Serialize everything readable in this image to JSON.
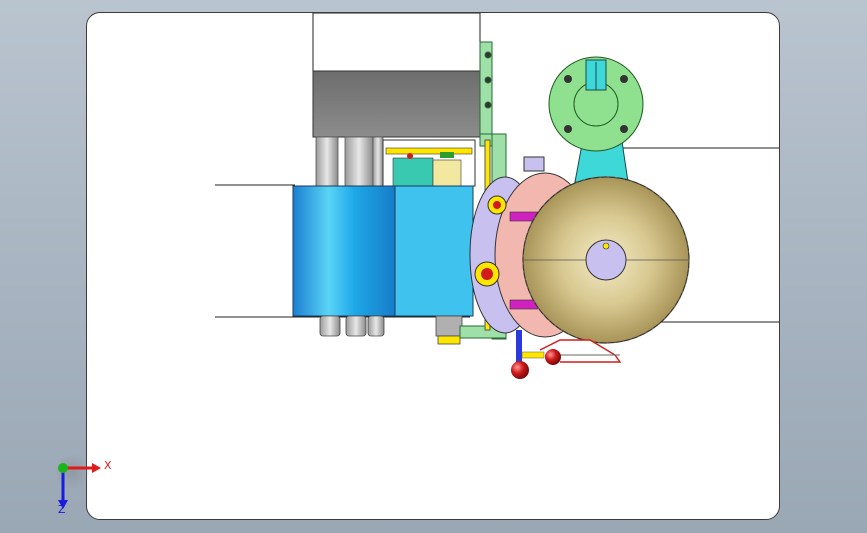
{
  "window": {
    "background": "#a7b3c0"
  },
  "triad": {
    "x_label": "X",
    "z_label": "Z",
    "x_color": "#e01a1a",
    "y_color": "#1ab51a",
    "z_color": "#1a1ae0"
  },
  "model": {
    "parts": [
      "base-block",
      "motor-housing",
      "cylinder-body",
      "side-plate",
      "flange-bracket",
      "dish-reflector",
      "hinge-bracket",
      "handle-knobs"
    ],
    "colors": {
      "motor": "#7a7a7a",
      "cylinder": "#1ea8e8",
      "cylinder_side": "#3fc2ee",
      "plate": "#9ee0a8",
      "flange": "#8fe08f",
      "bracket": "#3fd8d8",
      "dish": "#c8b880",
      "ring": "#f2b8b0",
      "lavender": "#c8c0ee",
      "magenta": "#d020c0",
      "knob": "#d11b1b"
    }
  }
}
